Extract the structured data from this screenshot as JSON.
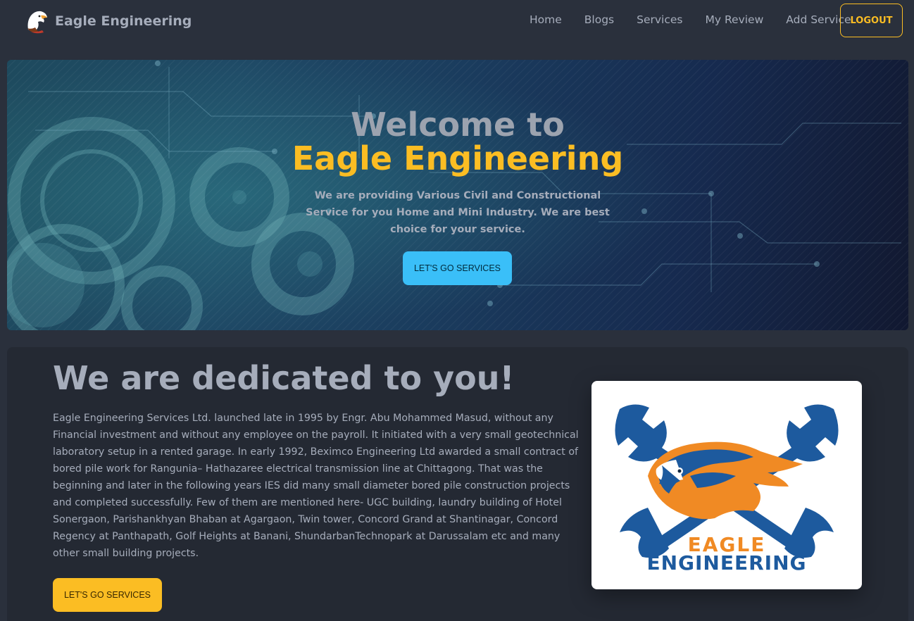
{
  "navbar": {
    "brand_name": "Eagle Engineering",
    "brand_icon": "eagle-logo-icon",
    "links": [
      "Home",
      "Blogs",
      "Services",
      "My Review",
      "Add Service"
    ],
    "logout_label": "LOGOUT"
  },
  "hero": {
    "title_line1": "Welcome to",
    "title_line2": "Eagle Engineering",
    "description": "We are providing Various Civil and Constructional Service for you Home and Mini Industry. We are best choice for your service.",
    "button_label": "LET'S GO SERVICES"
  },
  "about": {
    "title": "We are dedicated to you!",
    "text": "Eagle Engineering Services Ltd. launched late in 1995 by Engr. Abu Mohammed Masud, without any Financial investment and without any employee on the payroll. It initiated with a very small geotechnical laboratory setup in a rented garage. In early 1992, Beximco Engineering Ltd awarded a small contract of bored pile work for Rangunia– Hathazaree electrical transmission line at Chittagong. That was the beginning and later in the following years IES did many small diameter bored pile construction projects and completed successfully. Few of them are mentioned here- UGC building, laundry building of Hotel Sonergaon, Parishankhyan Bhaban at Agargaon, Twin tower, Concord Grand at Shantinagar, Concord Regency at Panthapath, Golf Heights at Banani, ShundarbanTechnopark at Darussalam etc and many other small building projects.",
    "button_label": "LET'S GO SERVICES",
    "logo_word1": "EAGLE",
    "logo_word2": "ENGINEERING"
  },
  "colors": {
    "background": "#2a303c",
    "accent_yellow": "#fbbd23",
    "accent_blue": "#3abff8",
    "text": "#a6adbb",
    "logo_blue": "#1d5a9e",
    "logo_orange": "#f08a24"
  }
}
